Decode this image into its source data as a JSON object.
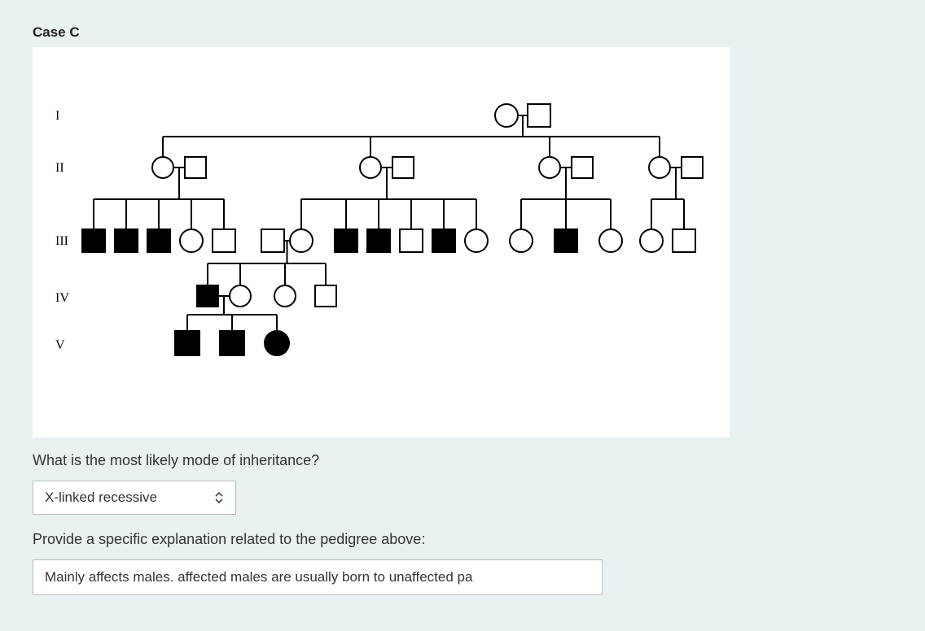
{
  "title": "Case C",
  "generations": [
    "I",
    "II",
    "III",
    "IV",
    "V"
  ],
  "question1": "What is the most likely mode of inheritance?",
  "select_value": "X-linked recessive",
  "question2": "Provide a specific explanation related to the pedigree above:",
  "explanation_value": "Mainly affects males. affected males are usually born to unaffected pa",
  "pedigree": {
    "legend": {
      "circle": "female",
      "square": "male",
      "filled": "affected",
      "open": "unaffected"
    },
    "people": [
      {
        "id": "I-1",
        "gen": 1,
        "sex": "F",
        "aff": false
      },
      {
        "id": "I-2",
        "gen": 1,
        "sex": "M",
        "aff": false
      },
      {
        "id": "II-1",
        "gen": 2,
        "sex": "F",
        "aff": false
      },
      {
        "id": "II-2",
        "gen": 2,
        "sex": "M",
        "aff": false
      },
      {
        "id": "II-3",
        "gen": 2,
        "sex": "F",
        "aff": false
      },
      {
        "id": "II-4",
        "gen": 2,
        "sex": "M",
        "aff": false
      },
      {
        "id": "II-5",
        "gen": 2,
        "sex": "F",
        "aff": false
      },
      {
        "id": "II-6",
        "gen": 2,
        "sex": "M",
        "aff": false
      },
      {
        "id": "II-7",
        "gen": 2,
        "sex": "F",
        "aff": false
      },
      {
        "id": "II-8",
        "gen": 2,
        "sex": "M",
        "aff": false
      },
      {
        "id": "III-1",
        "gen": 3,
        "sex": "M",
        "aff": true
      },
      {
        "id": "III-2",
        "gen": 3,
        "sex": "M",
        "aff": true
      },
      {
        "id": "III-3",
        "gen": 3,
        "sex": "M",
        "aff": true
      },
      {
        "id": "III-4",
        "gen": 3,
        "sex": "F",
        "aff": false
      },
      {
        "id": "III-5",
        "gen": 3,
        "sex": "M",
        "aff": false
      },
      {
        "id": "III-6",
        "gen": 3,
        "sex": "M",
        "aff": false
      },
      {
        "id": "III-7",
        "gen": 3,
        "sex": "F",
        "aff": false
      },
      {
        "id": "III-8",
        "gen": 3,
        "sex": "M",
        "aff": true
      },
      {
        "id": "III-9",
        "gen": 3,
        "sex": "M",
        "aff": true
      },
      {
        "id": "III-10",
        "gen": 3,
        "sex": "M",
        "aff": false
      },
      {
        "id": "III-11",
        "gen": 3,
        "sex": "M",
        "aff": true
      },
      {
        "id": "III-12",
        "gen": 3,
        "sex": "F",
        "aff": false
      },
      {
        "id": "III-13",
        "gen": 3,
        "sex": "F",
        "aff": false
      },
      {
        "id": "III-14",
        "gen": 3,
        "sex": "M",
        "aff": true
      },
      {
        "id": "III-15",
        "gen": 3,
        "sex": "F",
        "aff": false
      },
      {
        "id": "III-16",
        "gen": 3,
        "sex": "F",
        "aff": false
      },
      {
        "id": "III-17",
        "gen": 3,
        "sex": "M",
        "aff": false
      },
      {
        "id": "IV-1",
        "gen": 4,
        "sex": "M",
        "aff": true
      },
      {
        "id": "IV-2",
        "gen": 4,
        "sex": "F",
        "aff": false
      },
      {
        "id": "IV-3",
        "gen": 4,
        "sex": "F",
        "aff": false
      },
      {
        "id": "IV-4",
        "gen": 4,
        "sex": "M",
        "aff": false
      },
      {
        "id": "V-1",
        "gen": 5,
        "sex": "M",
        "aff": true
      },
      {
        "id": "V-2",
        "gen": 5,
        "sex": "M",
        "aff": true
      },
      {
        "id": "V-3",
        "gen": 5,
        "sex": "F",
        "aff": true
      }
    ],
    "matings": [
      [
        "I-1",
        "I-2"
      ],
      [
        "II-1",
        "II-2"
      ],
      [
        "II-3",
        "II-4"
      ],
      [
        "II-5",
        "II-6"
      ],
      [
        "II-7",
        "II-8"
      ],
      [
        "III-6",
        "III-7"
      ],
      [
        "IV-1",
        "IV-2"
      ]
    ],
    "offspring": {
      "I-1_I-2": [
        "II-1",
        "II-3",
        "II-5",
        "II-7"
      ],
      "II-1_II-2": [
        "III-1",
        "III-2",
        "III-3",
        "III-4",
        "III-5"
      ],
      "II-3_II-4": [
        "III-7",
        "III-8",
        "III-9",
        "III-10",
        "III-11",
        "III-12"
      ],
      "II-5_II-6": [
        "III-13",
        "III-14",
        "III-15"
      ],
      "II-7_II-8": [
        "III-16",
        "III-17"
      ],
      "III-6_III-7": [
        "IV-1",
        "IV-2",
        "IV-3",
        "IV-4"
      ],
      "IV-1_IV-2": [
        "V-1",
        "V-2",
        "V-3"
      ]
    }
  }
}
